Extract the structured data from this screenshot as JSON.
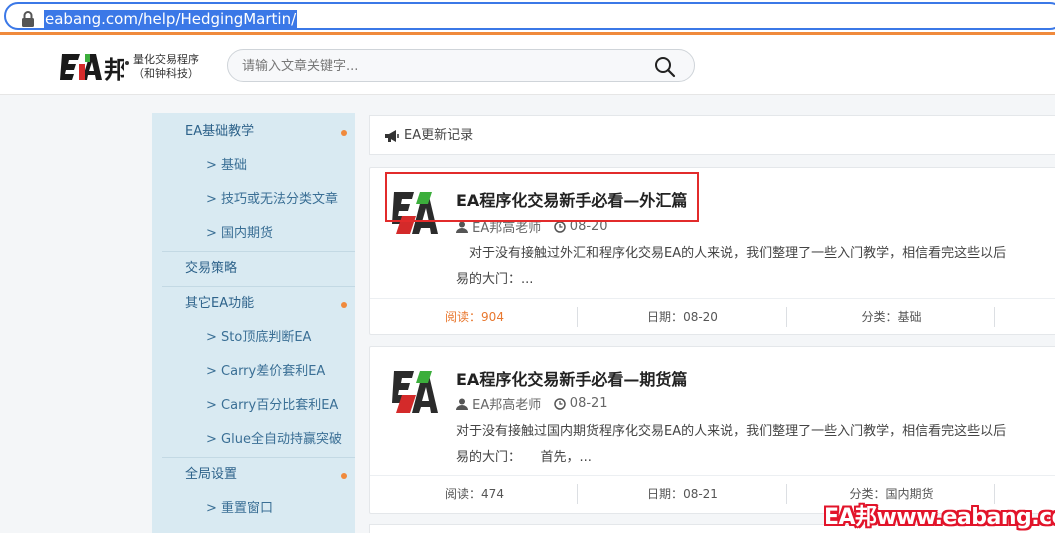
{
  "browser": {
    "url": "eabang.com/help/HedgingMartin/"
  },
  "header": {
    "logo_subtitle_line1": "量化交易程序",
    "logo_subtitle_line2": "（和钟科技）",
    "search_placeholder": "请输入文章关键字..."
  },
  "sidebar": {
    "items": [
      {
        "label": "EA基础教学",
        "level": "top",
        "dot": true
      },
      {
        "label": "> 基础",
        "level": "sub"
      },
      {
        "label": "> 技巧或无法分类文章",
        "level": "sub"
      },
      {
        "label": "> 国内期货",
        "level": "sub"
      },
      {
        "label": "交易策略",
        "level": "top",
        "dot": false
      },
      {
        "label": "其它EA功能",
        "level": "top",
        "dot": true
      },
      {
        "label": "> Sto顶底判断EA",
        "level": "sub"
      },
      {
        "label": "> Carry差价套利EA",
        "level": "sub"
      },
      {
        "label": "> Carry百分比套利EA",
        "level": "sub"
      },
      {
        "label": "> Glue全自动持赢突破",
        "level": "sub"
      },
      {
        "label": "全局设置",
        "level": "top",
        "dot": true
      },
      {
        "label": "> 重置窗口",
        "level": "sub"
      }
    ]
  },
  "notice": {
    "text": "EA更新记录"
  },
  "articles": [
    {
      "title": "EA程序化交易新手必看—外汇篇",
      "author": "EA邦高老师",
      "date_short": "08-20",
      "desc_line1": "　对于没有接触过外汇和程序化交易EA的人来说，我们整理了一些入门教学，相信看完这些以后",
      "desc_line2": "易的大门：...",
      "reads_label": "阅读：",
      "reads": "904",
      "date_label": "日期：",
      "date": "08-20",
      "category_label": "分类：",
      "category": "基础"
    },
    {
      "title": "EA程序化交易新手必看—期货篇",
      "author": "EA邦高老师",
      "date_short": "08-21",
      "desc_line1": "对于没有接触过国内期货程序化交易EA的人来说，我们整理了一些入门教学，相信看完这些以后",
      "desc_line2": "易的大门：　　首先，...",
      "reads_label": "阅读：",
      "reads": "474",
      "date_label": "日期：",
      "date": "08-21",
      "category_label": "分类：",
      "category": "国内期货"
    }
  ],
  "watermark": "EA邦www.eabang.com",
  "colors": {
    "accent_orange": "#f08a3c",
    "sidebar_bg": "#d9eaf2",
    "highlight_red": "#e22b2b",
    "url_blue": "#3b78e7"
  }
}
